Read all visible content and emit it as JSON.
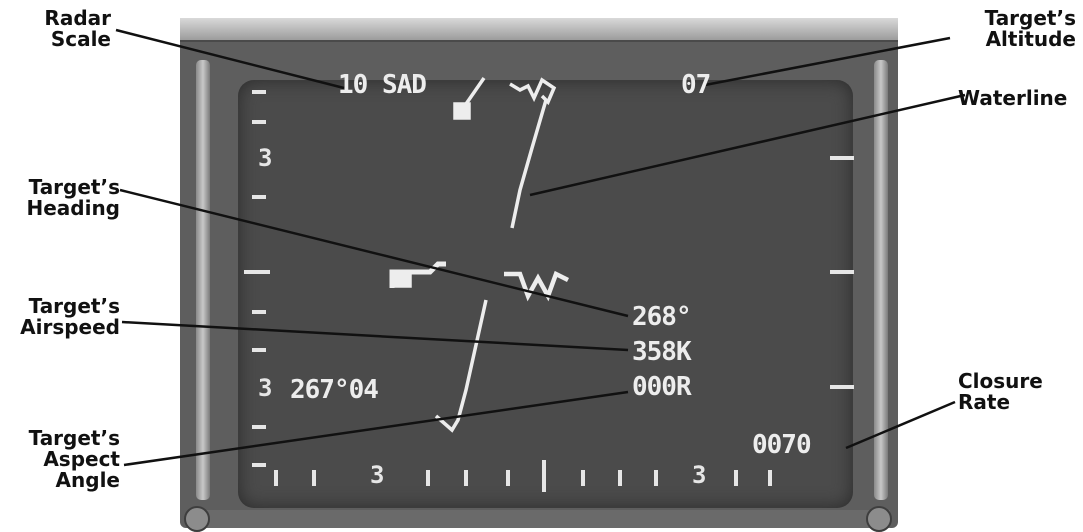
{
  "display": {
    "radar_scale": "10",
    "radar_mode": "SAD",
    "target_altitude": "07",
    "target_heading": "268°",
    "target_airspeed": "358K",
    "target_aspect": "000R",
    "bearing_range": "267°04",
    "closure_rate": "0070",
    "left_tick_upper": "3",
    "left_tick_lower": "3",
    "bottom_tick_left": "3",
    "bottom_tick_right": "3"
  },
  "callouts": {
    "radar_scale": [
      "Radar",
      "Scale"
    ],
    "target_altitude": [
      "Target’s",
      "Altitude"
    ],
    "waterline": [
      "Waterline"
    ],
    "target_heading": [
      "Target’s",
      "Heading"
    ],
    "target_airspeed": [
      "Target’s",
      "Airspeed"
    ],
    "target_aspect": [
      "Target’s",
      "Aspect",
      "Angle"
    ],
    "closure_rate": [
      "Closure",
      "Rate"
    ]
  },
  "colors": {
    "screen": "#4b4b4b",
    "symbology": "#ededed",
    "leader_line": "#111111"
  }
}
